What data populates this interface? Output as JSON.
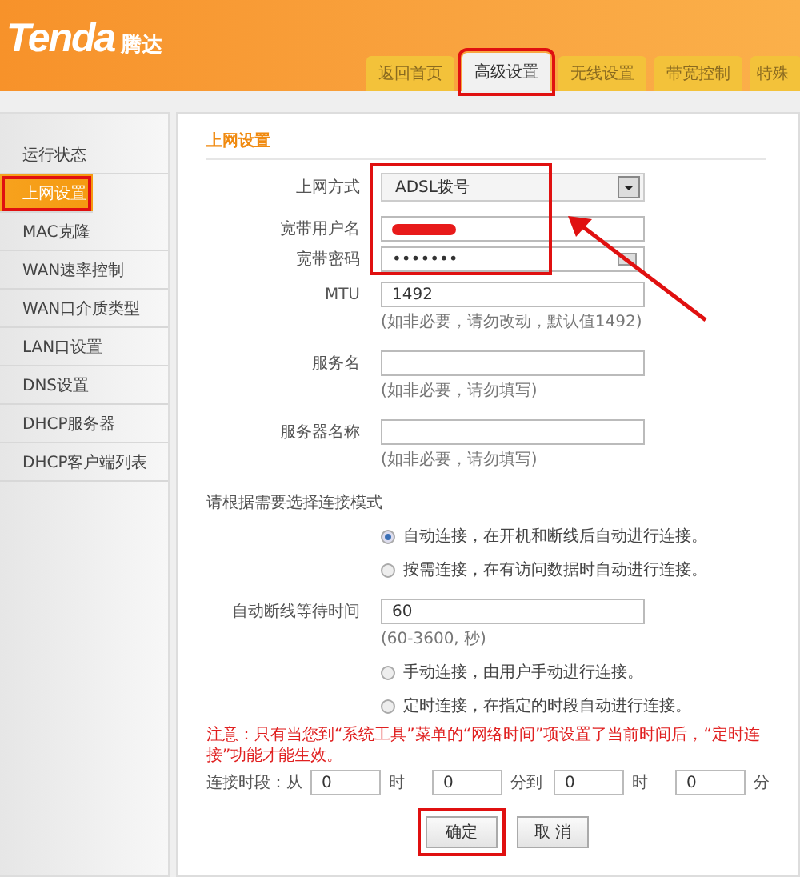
{
  "header": {
    "logo": "Tenda",
    "logo_cn": "腾达"
  },
  "tabs": [
    {
      "label": "返回首页",
      "selected": false,
      "highlighted": false
    },
    {
      "label": "高级设置",
      "selected": true,
      "highlighted": true
    },
    {
      "label": "无线设置",
      "selected": false,
      "highlighted": false
    },
    {
      "label": "带宽控制",
      "selected": false,
      "highlighted": false
    },
    {
      "label": "特殊",
      "selected": false,
      "highlighted": false
    }
  ],
  "sidebar": {
    "items": [
      {
        "label": "运行状态",
        "selected": false,
        "highlighted": false
      },
      {
        "label": "上网设置",
        "selected": true,
        "highlighted": true
      },
      {
        "label": "MAC克隆",
        "selected": false,
        "highlighted": false
      },
      {
        "label": "WAN速率控制",
        "selected": false,
        "highlighted": false
      },
      {
        "label": "WAN口介质类型",
        "selected": false,
        "highlighted": false
      },
      {
        "label": "LAN口设置",
        "selected": false,
        "highlighted": false
      },
      {
        "label": "DNS设置",
        "selected": false,
        "highlighted": false
      },
      {
        "label": "DHCP服务器",
        "selected": false,
        "highlighted": false
      },
      {
        "label": "DHCP客户端列表",
        "selected": false,
        "highlighted": false
      }
    ]
  },
  "section_title": "上网设置",
  "rows": [
    {
      "kind": "select",
      "label": "上网方式",
      "value": "ADSL拨号"
    },
    {
      "kind": "redacted",
      "label": "宽带用户名"
    },
    {
      "kind": "password",
      "label": "宽带密码",
      "value": "•••••••"
    },
    {
      "kind": "text",
      "label": "MTU",
      "value": "1492",
      "hint": "(如非必要，请勿改动，默认值1492)"
    },
    {
      "kind": "text",
      "label": "服务名",
      "hint": "(如非必要，请勿填写)"
    },
    {
      "kind": "text",
      "label": "服务器名称",
      "hint": "(如非必要，请勿填写)"
    },
    {
      "kind": "heading",
      "label": "请根据需要选择连接模式"
    },
    {
      "kind": "radio",
      "text": "自动连接，在开机和断线后自动进行连接。",
      "selected": true
    },
    {
      "kind": "radio",
      "text": "按需连接，在有访问数据时自动进行连接。",
      "selected": false
    },
    {
      "kind": "text",
      "label": "自动断线等待时间",
      "value": "60",
      "hint": "(60-3600, 秒)"
    },
    {
      "kind": "radio",
      "text": "手动连接，由用户手动进行连接。",
      "selected": false
    },
    {
      "kind": "radio",
      "text": "定时连接，在指定的时段自动进行连接。",
      "selected": false
    },
    {
      "kind": "note",
      "text": "注意：只有当您到“系统工具”菜单的“网络时间”项设置了当前时间后，“定时连接”功能才能生效。"
    },
    {
      "kind": "timerange",
      "label": "连接时段：从",
      "fields": [
        {
          "value": "0",
          "unit": "时"
        },
        {
          "value": "0",
          "unit": "分到"
        },
        {
          "value": "0",
          "unit": "时"
        },
        {
          "value": "0",
          "unit": "分"
        }
      ]
    }
  ],
  "buttons": [
    {
      "label": "确定",
      "highlighted": true
    },
    {
      "label": "取 消",
      "highlighted": false
    }
  ]
}
